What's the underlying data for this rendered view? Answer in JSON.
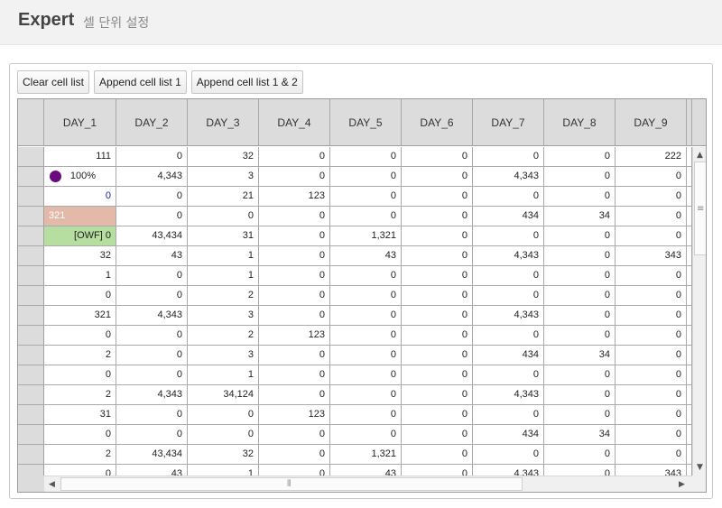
{
  "header": {
    "title": "Expert",
    "subtitle": "셀 단위 설정"
  },
  "toolbar": {
    "buttons": [
      {
        "id": "clear-cell-list-button",
        "label": "Clear cell list"
      },
      {
        "id": "append-cell-list-1-button",
        "label": "Append cell list 1"
      },
      {
        "id": "append-cell-list-1-2-button",
        "label": "Append cell list 1 & 2"
      }
    ]
  },
  "grid": {
    "columns": [
      "DAY_1",
      "DAY_2",
      "DAY_3",
      "DAY_4",
      "DAY_5",
      "DAY_6",
      "DAY_7",
      "DAY_8",
      "DAY_9"
    ],
    "rows": [
      [
        "111",
        "0",
        "32",
        "0",
        "0",
        "0",
        "0",
        "0",
        "222"
      ],
      [
        "100%",
        "4,343",
        "3",
        "0",
        "0",
        "0",
        "4,343",
        "0",
        "0"
      ],
      [
        "0",
        "0",
        "21",
        "123",
        "0",
        "0",
        "0",
        "0",
        "0"
      ],
      [
        "321",
        "0",
        "0",
        "0",
        "0",
        "0",
        "434",
        "34",
        "0"
      ],
      [
        "[OWF] 0",
        "43,434",
        "31",
        "0",
        "1,321",
        "0",
        "0",
        "0",
        "0"
      ],
      [
        "32",
        "43",
        "1",
        "0",
        "43",
        "0",
        "4,343",
        "0",
        "343"
      ],
      [
        "1",
        "0",
        "1",
        "0",
        "0",
        "0",
        "0",
        "0",
        "0"
      ],
      [
        "0",
        "0",
        "2",
        "0",
        "0",
        "0",
        "0",
        "0",
        "0"
      ],
      [
        "321",
        "4,343",
        "3",
        "0",
        "0",
        "0",
        "4,343",
        "0",
        "0"
      ],
      [
        "0",
        "0",
        "2",
        "123",
        "0",
        "0",
        "0",
        "0",
        "0"
      ],
      [
        "2",
        "0",
        "3",
        "0",
        "0",
        "0",
        "434",
        "34",
        "0"
      ],
      [
        "0",
        "0",
        "1",
        "0",
        "0",
        "0",
        "0",
        "0",
        "0"
      ],
      [
        "2",
        "4,343",
        "34,124",
        "0",
        "0",
        "0",
        "4,343",
        "0",
        "0"
      ],
      [
        "31",
        "0",
        "0",
        "123",
        "0",
        "0",
        "0",
        "0",
        "0"
      ],
      [
        "0",
        "0",
        "0",
        "0",
        "0",
        "0",
        "434",
        "34",
        "0"
      ],
      [
        "2",
        "43,434",
        "32",
        "0",
        "1,321",
        "0",
        "0",
        "0",
        "0"
      ],
      [
        "0",
        "43",
        "1",
        "0",
        "43",
        "0",
        "4,343",
        "0",
        "343"
      ]
    ],
    "special_cells": {
      "progress_dot_color": "#6a0a7d",
      "blue_text_color": "#1f1fb0",
      "salmon_background": "#e3b9aa",
      "green_background": "#b5dea0"
    }
  },
  "icons": {
    "scroll_up": "arrow-up-icon",
    "scroll_down": "arrow-down-icon",
    "scroll_left": "arrow-left-icon",
    "scroll_right": "arrow-right-icon",
    "grip": "grip-icon"
  }
}
